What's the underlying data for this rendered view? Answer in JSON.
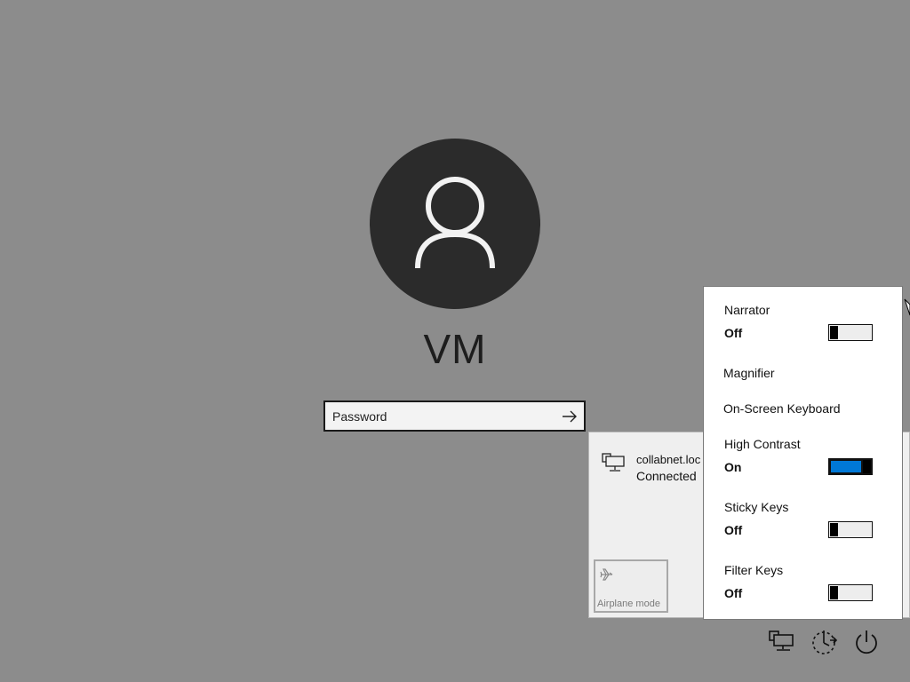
{
  "user": {
    "name": "VM"
  },
  "password": {
    "placeholder": "Password",
    "value": ""
  },
  "network": {
    "name": "collabnet.loc",
    "status": "Connected",
    "airplane_label": "Airplane mode"
  },
  "ease_of_access": {
    "narrator": {
      "label": "Narrator",
      "state": "Off"
    },
    "magnifier": {
      "label": "Magnifier"
    },
    "onscreen_keyboard": {
      "label": "On-Screen Keyboard"
    },
    "high_contrast": {
      "label": "High Contrast",
      "state": "On"
    },
    "sticky_keys": {
      "label": "Sticky Keys",
      "state": "Off"
    },
    "filter_keys": {
      "label": "Filter Keys",
      "state": "Off"
    }
  },
  "icons": {
    "avatar": "user-icon",
    "submit": "arrow-right-icon",
    "network": "network-icon",
    "airplane": "airplane-icon",
    "ease": "ease-of-access-icon",
    "power": "power-icon"
  },
  "colors": {
    "background": "#8c8c8c",
    "avatar_bg": "#2b2b2b",
    "toggle_on": "#0078d7"
  }
}
